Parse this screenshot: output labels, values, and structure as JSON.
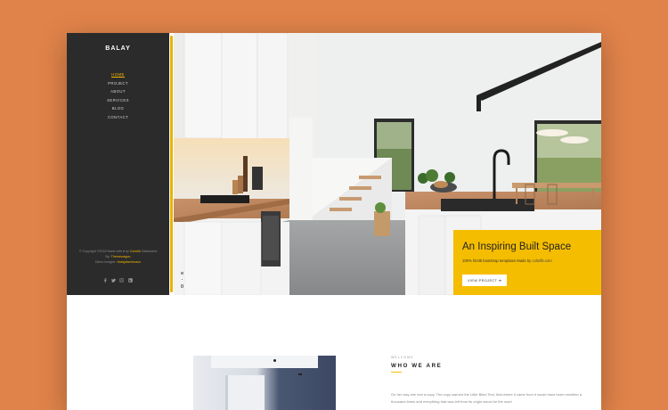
{
  "sidebar": {
    "logo": "BALAY",
    "nav": [
      {
        "label": "HOME",
        "active": true
      },
      {
        "label": "PROJECT",
        "active": false
      },
      {
        "label": "ABOUT",
        "active": false
      },
      {
        "label": "SERVICES",
        "active": false
      },
      {
        "label": "BLOG",
        "active": false
      },
      {
        "label": "CONTACT",
        "active": false
      }
    ],
    "footer": {
      "line1_text": "© Copyright ©2018 Made with",
      "heart": "♥",
      "line1_by": "by",
      "line1_link": "Colorlib",
      "line1_tail": "Distributed",
      "line2_by": "By:",
      "line2_link": "Themewagon",
      "line3_text": "Demo Images:",
      "line3_link": "Vodsjalachevaco"
    },
    "social": [
      "f",
      "t",
      "ig",
      "in"
    ]
  },
  "hero": {
    "title": "An Inspiring Built Space",
    "subtitle": "100% html5 bootstrap templates Made by",
    "subtitle_link": "colorlib.com",
    "button": "VIEW PROJECT ➜",
    "slides": 3,
    "active_slide": 2
  },
  "about": {
    "eyebrow": "WELCOME",
    "heading": "WHO WE ARE",
    "para": "On her way she met a copy. The copy warned the Little Blind Text, that where it came from it would have been rewritten a thousand times and everything that was left from its origin would be the word"
  },
  "colors": {
    "accent": "#f5bd00",
    "sidebar_bg": "#2b2b2b",
    "page_bg": "#e0834a"
  }
}
